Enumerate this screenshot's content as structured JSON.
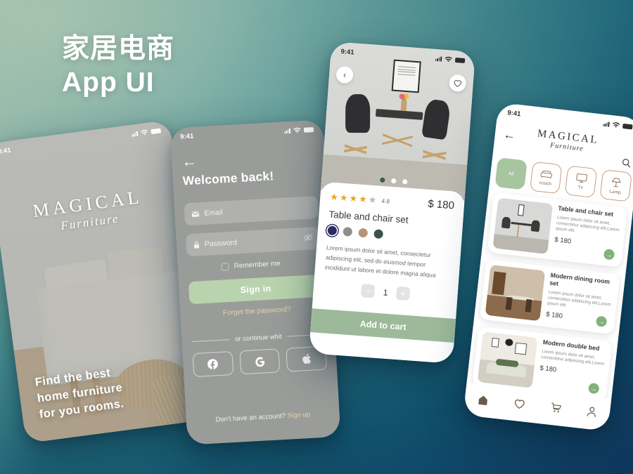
{
  "headline": "家居电商\nApp UI",
  "colors": {
    "accent_green": "#a7c6a0",
    "button_green": "#9cba9a",
    "link_gold": "#e4d2a8",
    "bg_top_left": "#a9c3ae",
    "bg_bottom_right": "#123a60",
    "star_gold": "#e8a722"
  },
  "status_bar": {
    "time": "9:41"
  },
  "splash": {
    "logo_mark": "MAGICAL",
    "logo_sub": "Furniture",
    "tagline": "Find the best\nhome furniture\nfor you rooms."
  },
  "login": {
    "back_icon": "back-arrow-icon",
    "title": "Welcome back!",
    "email": {
      "placeholder": "Email",
      "value": "",
      "icon": "envelope-icon"
    },
    "password": {
      "placeholder": "Password",
      "value": "",
      "icon": "lock-icon",
      "toggle_icon": "eye-off-icon"
    },
    "remember_label": "Remember me",
    "signin_label": "Sign in",
    "forgot_label": "Forget the password?",
    "divider_label": "or continue whit",
    "socials": [
      {
        "name": "facebook",
        "glyph": "f"
      },
      {
        "name": "google",
        "glyph": "G"
      },
      {
        "name": "apple",
        "glyph": ""
      }
    ],
    "footer_text": "Don't have an account?",
    "footer_link": "Sign up"
  },
  "product": {
    "back_icon": "chevron-left-icon",
    "favorite_icon": "heart-outline-icon",
    "carousel_dots": 3,
    "carousel_active": 0,
    "stars_filled": 4,
    "stars_total": 5,
    "rating": "4.8",
    "price": "$ 180",
    "name": "Table and chair set",
    "swatches": [
      {
        "name": "dark-navy",
        "hex": "#2b2b60",
        "selected": true
      },
      {
        "name": "gray",
        "hex": "#8e8e8e",
        "selected": false
      },
      {
        "name": "tan",
        "hex": "#b69477",
        "selected": false
      },
      {
        "name": "dark-green",
        "hex": "#3c5248",
        "selected": false
      }
    ],
    "description": "Lorem ipsum dolor sit amet, consectetur adipiscing elit, sed do eiusmod tempor incididunt ut labore et dolore magna aliqua",
    "quantity": "1",
    "decrement_label": "−",
    "increment_label": "+",
    "add_to_cart_label": "Add to cart"
  },
  "catalog": {
    "back_icon": "back-arrow-icon",
    "logo_mark": "MAGICAL",
    "logo_sub": "Furniture",
    "search_icon": "search-icon",
    "categories": [
      {
        "label": "All",
        "icon": "all-icon",
        "active": true
      },
      {
        "label": "couch",
        "icon": "couch-icon",
        "active": false
      },
      {
        "label": "Tv",
        "icon": "tv-icon",
        "active": false
      },
      {
        "label": "Lamp",
        "icon": "lamp-icon",
        "active": false
      },
      {
        "label": "",
        "icon": "more-icon",
        "active": false
      }
    ],
    "products": [
      {
        "title": "Table and chair set",
        "desc": "Lorem ipsum dolor sit amet, consectetur adipiscing elit.Lorem ipsum elit.",
        "price": "$ 180",
        "go_icon": "arrow-right-icon"
      },
      {
        "title": "Modern dining room set",
        "desc": "Lorem ipsum dolor sit amet, consectetur adipiscing elit.Lorem ipsum elit.",
        "price": "$ 180",
        "go_icon": "arrow-right-icon"
      },
      {
        "title": "Modern double bed",
        "desc": "Lorem ipsum dolor sit amet, consectetur adipiscing elit.Lorem",
        "price": "$ 180",
        "go_icon": "arrow-right-icon"
      }
    ],
    "nav": [
      {
        "name": "home",
        "glyph": "⌂"
      },
      {
        "name": "favorites",
        "glyph": "♡"
      },
      {
        "name": "cart",
        "glyph": "🛒"
      },
      {
        "name": "profile",
        "glyph": "○"
      }
    ]
  }
}
